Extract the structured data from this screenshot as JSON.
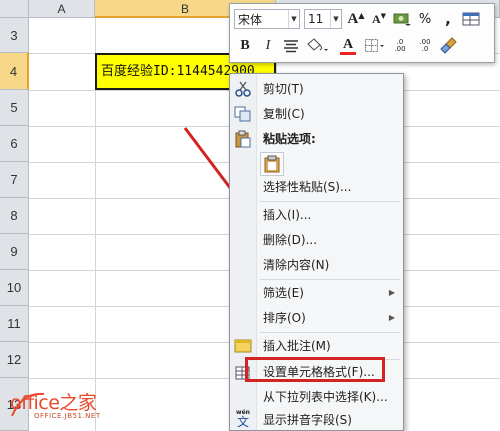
{
  "columns": [
    "A",
    "B"
  ],
  "rows": [
    "3",
    "4",
    "5",
    "6",
    "7",
    "8",
    "9",
    "10",
    "11",
    "12",
    "13"
  ],
  "cell_b4": "百度经验ID:1144542900",
  "mini_toolbar": {
    "font_name": "宋体",
    "font_size": "11",
    "grow_font": "A",
    "shrink_font": "A",
    "percent": "%",
    "comma": ",",
    "bold": "B",
    "italic": "I",
    "font_color": "A",
    "dec_increase": ".0\n.00",
    "dec_decrease": ".00\n.0"
  },
  "context_menu": {
    "cut": "剪切(T)",
    "copy": "复制(C)",
    "paste_options": "粘贴选项:",
    "paste_special": "选择性粘贴(S)...",
    "insert": "插入(I)...",
    "delete": "删除(D)...",
    "clear_contents": "清除内容(N)",
    "filter": "筛选(E)",
    "sort": "排序(O)",
    "insert_comment": "插入批注(M)",
    "format_cells": "设置单元格格式(F)...",
    "pick_from_list": "从下拉列表中选择(K)...",
    "show_phonetic": "显示拼音字段(S)",
    "phonetic_icon_text": "wén",
    "phonetic_icon_char": "文"
  },
  "logo": {
    "main": "office之家",
    "sub": "OFFICE.JB51.NET"
  },
  "colors": {
    "selected_cell_fill": "#ffff00",
    "highlight_box": "#d42323",
    "arrow": "#d42323",
    "selected_header": "#f7d889"
  }
}
